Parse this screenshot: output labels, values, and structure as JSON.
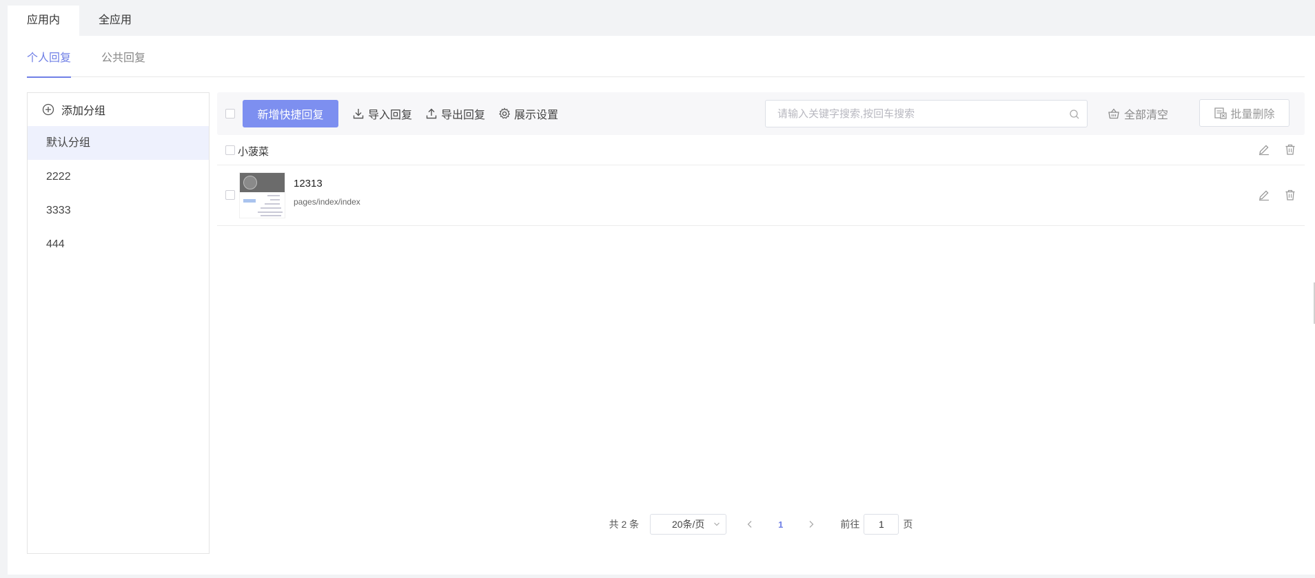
{
  "top_tabs": [
    {
      "label": "应用内",
      "active": true
    },
    {
      "label": "全应用",
      "active": false
    }
  ],
  "sub_tabs": [
    {
      "label": "个人回复",
      "active": true
    },
    {
      "label": "公共回复",
      "active": false
    }
  ],
  "groups": {
    "add_label": "添加分组",
    "items": [
      {
        "label": "默认分组",
        "active": true
      },
      {
        "label": "2222"
      },
      {
        "label": "3333"
      },
      {
        "label": "444"
      }
    ]
  },
  "toolbar": {
    "add_reply": "新增快捷回复",
    "import": "导入回复",
    "export": "导出回复",
    "display_settings": "展示设置",
    "search_placeholder": "请输入关键字搜索,按回车搜索",
    "clear_all": "全部清空",
    "batch_delete": "批量删除"
  },
  "list": {
    "group_title": "小菠菜",
    "items": [
      {
        "title": "12313",
        "path": "pages/index/index"
      }
    ]
  },
  "pagination": {
    "total_text": "共 2 条",
    "page_size": "20条/页",
    "current_page": "1",
    "goto_prefix": "前往",
    "goto_value": "1",
    "goto_suffix": "页"
  },
  "colors": {
    "accent": "#6f7fe6",
    "primary_button": "#7d8ff0",
    "active_group_bg": "#eef1fd"
  }
}
